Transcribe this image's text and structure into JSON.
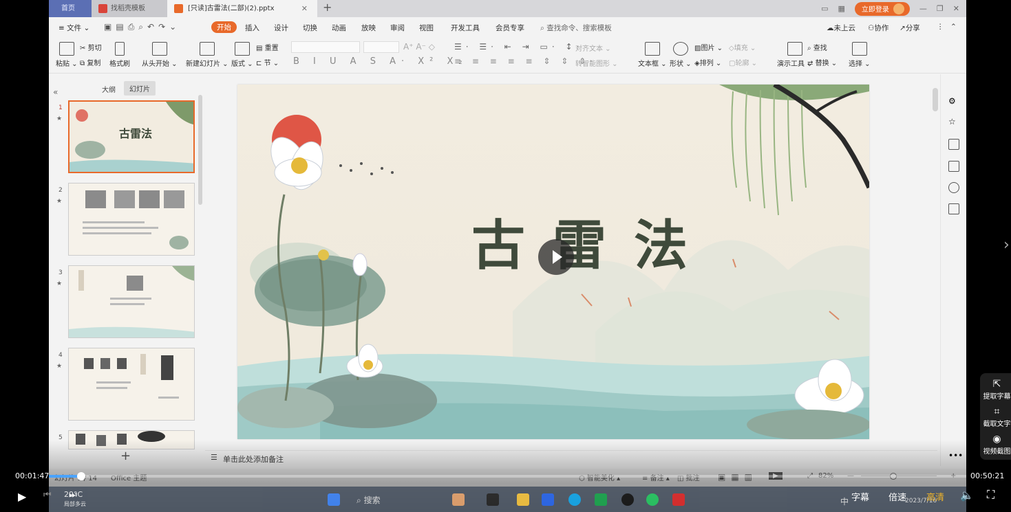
{
  "window": {
    "tabs": [
      {
        "label": "首页"
      },
      {
        "label": "找稻壳模板"
      },
      {
        "label": "[只读]古雷法(二部)(2).pptx"
      }
    ],
    "login_label": "立即登录"
  },
  "menu": {
    "file": "文件",
    "items": [
      "开始",
      "插入",
      "设计",
      "切换",
      "动画",
      "放映",
      "审阅",
      "视图",
      "开发工具",
      "会员专享"
    ],
    "search_placeholder": "查找命令、搜索模板",
    "cloud": "未上云",
    "collab": "协作",
    "share": "分享"
  },
  "ribbon": {
    "paste": "粘贴",
    "cut": "剪切",
    "copy": "复制",
    "format_painter": "格式刷",
    "from_start": "从头开始",
    "new_slide": "新建幻灯片",
    "layout": "版式",
    "reset": "重置",
    "section": "节",
    "align_text": "对齐文本",
    "to_smartart": "转智能图形",
    "textbox": "文本框",
    "shapes": "形状",
    "image": "图片",
    "fill": "填充",
    "arrange": "排列",
    "outline": "轮廓",
    "present_tools": "演示工具",
    "find": "查找",
    "replace": "替换",
    "select": "选择"
  },
  "left_panel": {
    "tab_outline": "大纲",
    "tab_slides": "幻灯片",
    "slides": [
      {
        "number": "1",
        "title": "古雷法"
      },
      {
        "number": "2"
      },
      {
        "number": "3"
      },
      {
        "number": "4"
      },
      {
        "number": "5"
      }
    ]
  },
  "slide": {
    "title": "古雷法"
  },
  "notes": {
    "placeholder": "单击此处添加备注"
  },
  "status_bar": {
    "slide_label": "幻灯片",
    "slide_count": "1 / 14",
    "theme": "Office 主题",
    "beautify": "智能美化",
    "notes": "备注",
    "comments": "批注",
    "zoom": "82%"
  },
  "taskbar": {
    "weather": "29°C",
    "weather_sub": "局部多云",
    "search": "搜索",
    "ime": "中",
    "date": "2023/7/16"
  },
  "player": {
    "current_time": "00:01:47",
    "total_time": "00:50:21",
    "progress_fraction": 0.035,
    "subtitle_btn": "字幕",
    "speed_btn": "倍速",
    "quality_btn": "高清"
  },
  "side_panel": {
    "extract_subtitles": "提取字幕",
    "extract_text": "截取文字",
    "video_screenshot": "视频截图"
  }
}
